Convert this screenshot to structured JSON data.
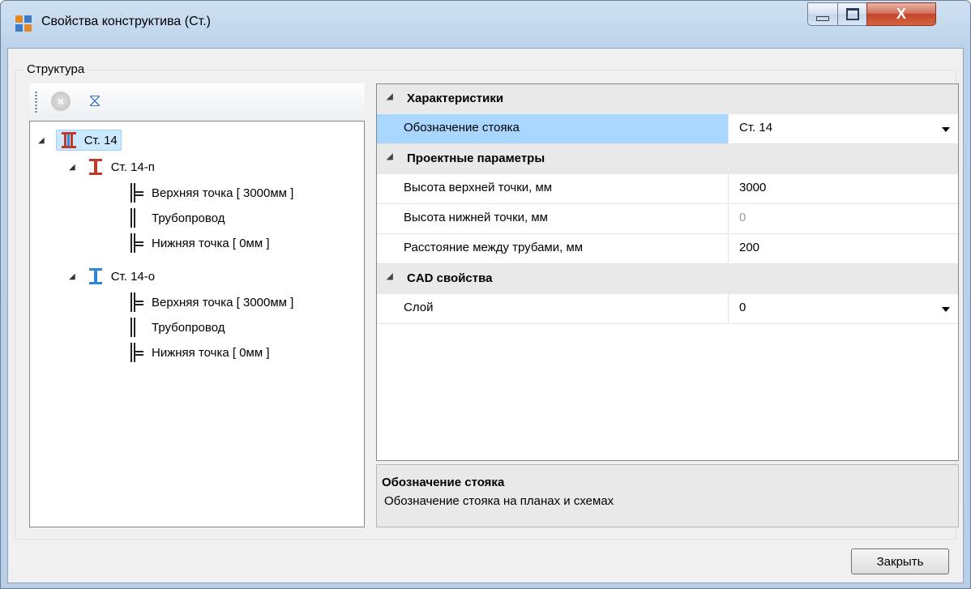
{
  "window": {
    "title": "Свойства конструктива (Ст.)",
    "close_glyph": "X"
  },
  "group": {
    "label": "Структура"
  },
  "toolbar": {
    "icons": [
      "cancel-icon",
      "filter-icon"
    ]
  },
  "tree": {
    "root": {
      "label": "Ст. 14",
      "icon": "ibeam-red-blue-icon"
    },
    "children": [
      {
        "label": "Ст. 14-п",
        "icon": "ibeam-red-icon",
        "items": [
          {
            "label": "Верхняя точка [ 3000мм ]"
          },
          {
            "label": "Трубопровод"
          },
          {
            "label": "Нижняя точка [ 0мм ]"
          }
        ]
      },
      {
        "label": "Ст. 14-о",
        "icon": "ibeam-blue-icon",
        "items": [
          {
            "label": "Верхняя точка [ 3000мм ]"
          },
          {
            "label": "Трубопровод"
          },
          {
            "label": "Нижняя точка [ 0мм ]"
          }
        ]
      }
    ]
  },
  "grid": {
    "cat1": {
      "label": "Характеристики"
    },
    "p1": {
      "name": "Обозначение стояка",
      "value": "Ст. 14"
    },
    "cat2": {
      "label": "Проектные параметры"
    },
    "p2": {
      "name": "Высота верхней точки, мм",
      "value": "3000"
    },
    "p3": {
      "name": "Высота нижней точки, мм",
      "value": "0"
    },
    "p4": {
      "name": "Расстояние между трубами, мм",
      "value": "200"
    },
    "cat3": {
      "label": "CAD свойства"
    },
    "p5": {
      "name": "Слой",
      "value": "0"
    }
  },
  "description": {
    "title": "Обозначение стояка",
    "text": "Обозначение стояка на планах и схемах"
  },
  "buttons": {
    "close": "Закрыть"
  },
  "colors": {
    "selection": "#a8d6ff",
    "tree_highlight": "#cce8ff",
    "category_bg": "#e9e9e9",
    "close_red": "#c2452b"
  }
}
